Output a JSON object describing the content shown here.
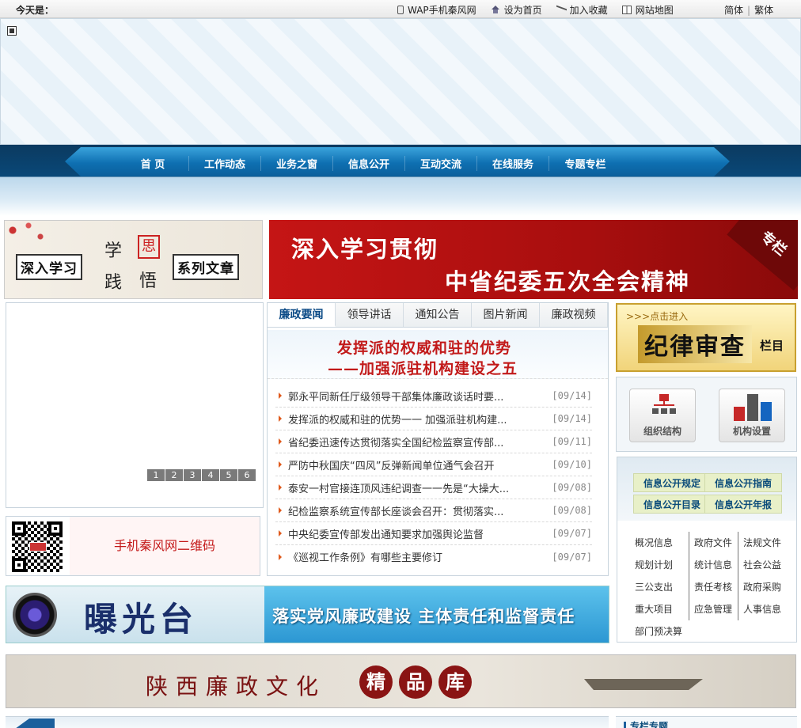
{
  "topbar": {
    "today_label": "今天是：",
    "links": [
      {
        "icon": "phone-icon",
        "label": "WAP手机秦风网"
      },
      {
        "icon": "home-icon",
        "label": "设为首页"
      },
      {
        "icon": "bookmark-icon",
        "label": "加入收藏"
      },
      {
        "icon": "sitemap-icon",
        "label": "网站地图"
      }
    ],
    "lang_simplified": "简体",
    "lang_traditional": "繁体",
    "lang_sep": "|"
  },
  "nav": {
    "items": [
      "首 页",
      "工作动态",
      "业务之窗",
      "信息公开",
      "互动交流",
      "在线服务",
      "专题专栏"
    ]
  },
  "promo_left": {
    "box1": "深入学习",
    "box2": "系列文章",
    "char_xue": "学",
    "char_si": "思",
    "char_jian": "践",
    "char_wu": "悟"
  },
  "promo_right": {
    "line1": "深入学习贯彻",
    "line2": "中省纪委五次全会精神",
    "corner": "专栏"
  },
  "slideshow": {
    "pages": [
      "1",
      "2",
      "3",
      "4",
      "5",
      "6"
    ]
  },
  "qr": {
    "label": "手机秦风网二维码"
  },
  "news": {
    "tabs": [
      "廉政要闻",
      "领导讲话",
      "通知公告",
      "图片新闻",
      "廉政视频"
    ],
    "headline_line1": "发挥派的权威和驻的优势",
    "headline_line2": "——加强派驻机构建设之五",
    "items": [
      {
        "title": "郭永平同新任厅级领导干部集体廉政谈话时要...",
        "date": "[09/14]"
      },
      {
        "title": "发挥派的权威和驻的优势一一 加强派驻机构建...",
        "date": "[09/14]"
      },
      {
        "title": "省纪委迅速传达贯彻落实全国纪检监察宣传部...",
        "date": "[09/11]"
      },
      {
        "title": "严防中秋国庆“四风”反弹新闻单位通气会召开",
        "date": "[09/10]"
      },
      {
        "title": "泰安一村官接连顶风违纪调查一一先是“大操大...",
        "date": "[09/08]"
      },
      {
        "title": "纪检监察系统宣传部长座谈会召开：贯彻落实...",
        "date": "[09/08]"
      },
      {
        "title": "中央纪委宣传部发出通知要求加强舆论监督",
        "date": "[09/07]"
      },
      {
        "title": "《巡视工作条例》有哪些主要修订",
        "date": "[09/07]"
      }
    ]
  },
  "review": {
    "sub": ">>>点击进入",
    "main": "纪律审查",
    "tail": "栏目"
  },
  "org": {
    "structure": "组织结构",
    "setup": "机构设置"
  },
  "info": {
    "btn1": "信息公开规定",
    "btn2": "信息公开指南",
    "btn3": "信息公开目录",
    "btn4": "信息公开年报",
    "links": [
      "概况信息",
      "政府文件",
      "法规文件",
      "规划计划",
      "统计信息",
      "社会公益",
      "三公支出",
      "责任考核",
      "政府采购",
      "重大项目",
      "应急管理",
      "人事信息",
      "部门预决算"
    ]
  },
  "expose": {
    "title": "曝光台",
    "slogan": "落实党风廉政建设  主体责任和监督责任"
  },
  "culture": {
    "title": "陕西廉政文化",
    "c1": "精",
    "c2": "品",
    "c3": "库"
  },
  "bottom": {
    "right_title": "专栏专题"
  }
}
